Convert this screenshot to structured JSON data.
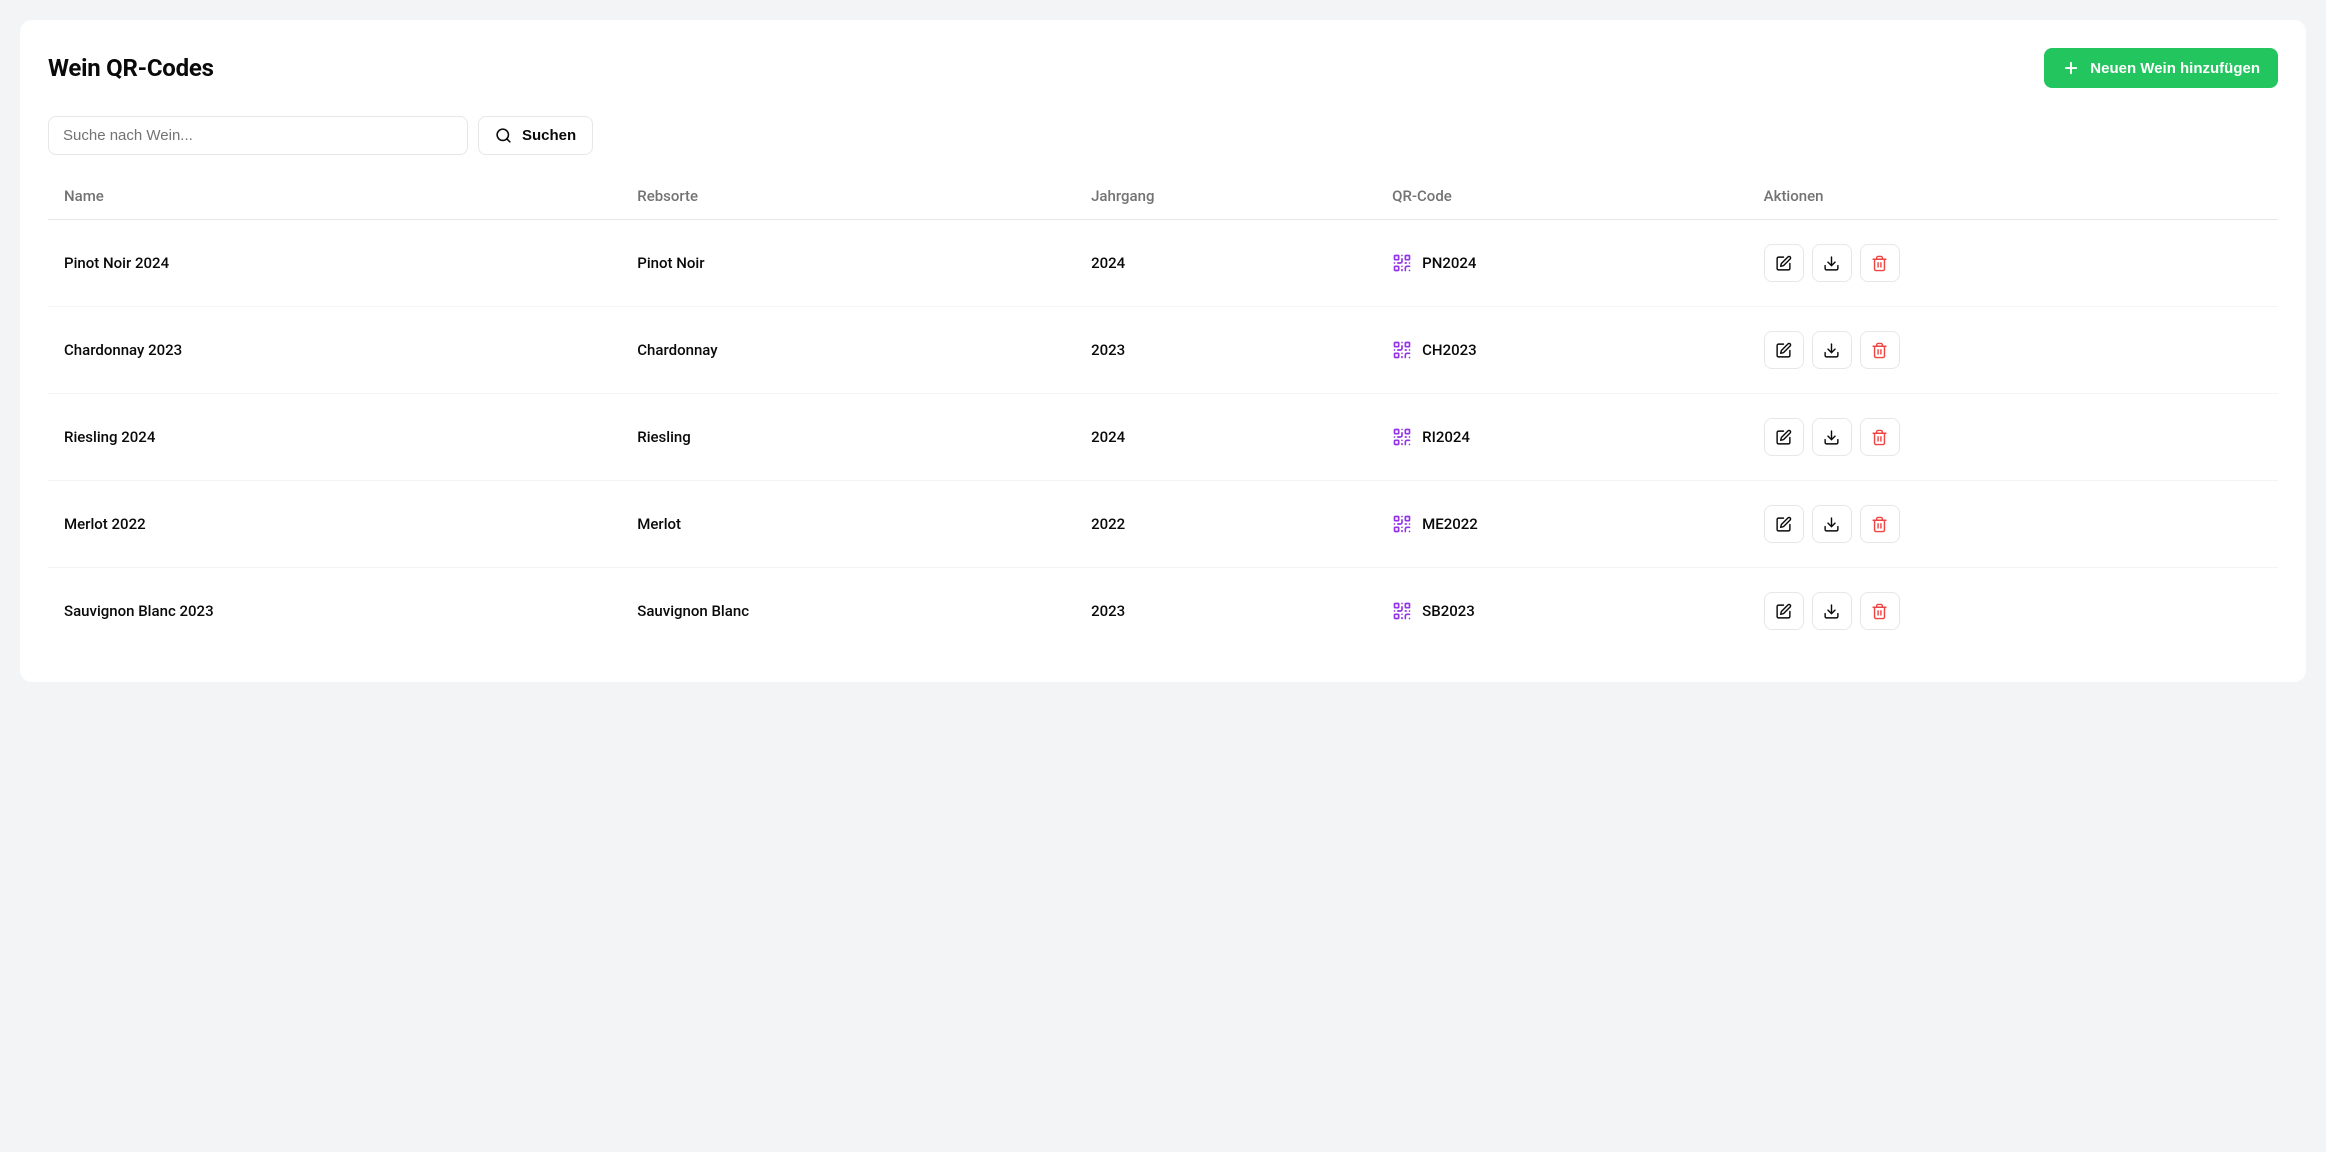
{
  "header": {
    "title": "Wein QR-Codes",
    "add_button_label": "Neuen Wein hinzufügen"
  },
  "search": {
    "placeholder": "Suche nach Wein...",
    "button_label": "Suchen"
  },
  "table": {
    "columns": {
      "name": "Name",
      "variety": "Rebsorte",
      "year": "Jahrgang",
      "qrcode": "QR-Code",
      "actions": "Aktionen"
    },
    "rows": [
      {
        "name": "Pinot Noir 2024",
        "variety": "Pinot Noir",
        "year": "2024",
        "qrcode": "PN2024"
      },
      {
        "name": "Chardonnay 2023",
        "variety": "Chardonnay",
        "year": "2023",
        "qrcode": "CH2023"
      },
      {
        "name": "Riesling 2024",
        "variety": "Riesling",
        "year": "2024",
        "qrcode": "RI2024"
      },
      {
        "name": "Merlot 2022",
        "variety": "Merlot",
        "year": "2022",
        "qrcode": "ME2022"
      },
      {
        "name": "Sauvignon Blanc 2023",
        "variety": "Sauvignon Blanc",
        "year": "2023",
        "qrcode": "SB2023"
      }
    ]
  }
}
